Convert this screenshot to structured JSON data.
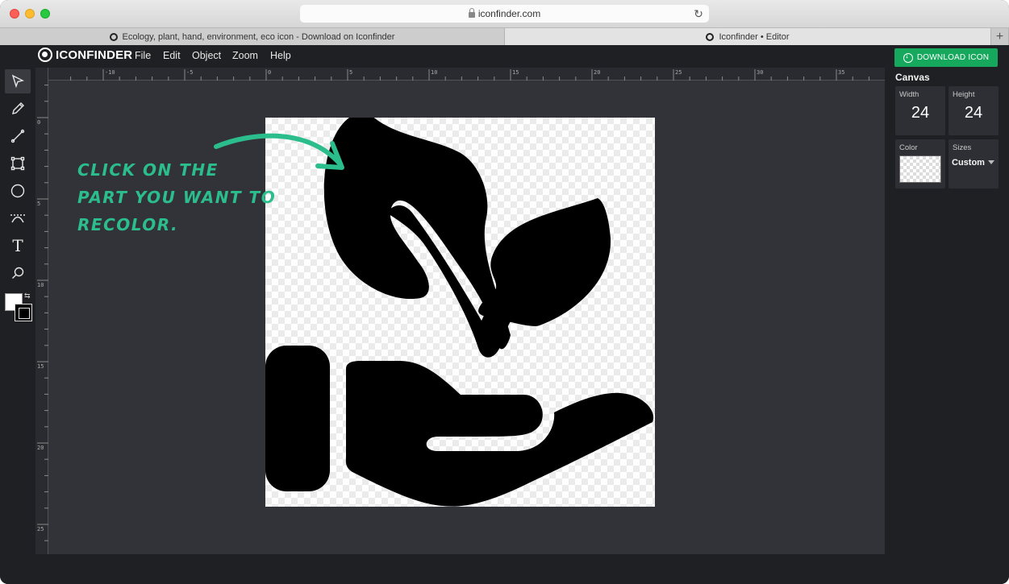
{
  "browser": {
    "url": "iconfinder.com",
    "tabs": [
      {
        "label": "Ecology, plant, hand, environment, eco icon - Download on Iconfinder"
      },
      {
        "label": "Iconfinder • Editor"
      }
    ],
    "new_tab_label": "+"
  },
  "app": {
    "logo_text": "ICONFINDER",
    "menu": [
      "File",
      "Edit",
      "Object",
      "Zoom",
      "Help"
    ],
    "download_label": "DOWNLOAD ICON"
  },
  "tools": [
    "select-tool",
    "pencil-tool",
    "line-tool",
    "rectangle-tool",
    "ellipse-tool",
    "bezier-tool",
    "text-tool",
    "zoom-tool"
  ],
  "text_tool_glyph": "T",
  "ruler": {
    "top_labels": [
      "-10",
      "-5",
      "0",
      "5",
      "10",
      "15",
      "20",
      "25",
      "30",
      "35"
    ],
    "left_labels": [
      "0",
      "5",
      "10",
      "15",
      "20",
      "25"
    ]
  },
  "annotation": {
    "lines": [
      "Click on the",
      "part you want to",
      "recolor."
    ],
    "color": "#2bbd8c"
  },
  "panel": {
    "title": "Canvas",
    "width_label": "Width",
    "width_value": "24",
    "height_label": "Height",
    "height_value": "24",
    "color_label": "Color",
    "sizes_label": "Sizes",
    "sizes_value": "Custom"
  },
  "colors": {
    "accent": "#16a85c",
    "workspace": "#323339",
    "chrome": "#1f2024"
  }
}
